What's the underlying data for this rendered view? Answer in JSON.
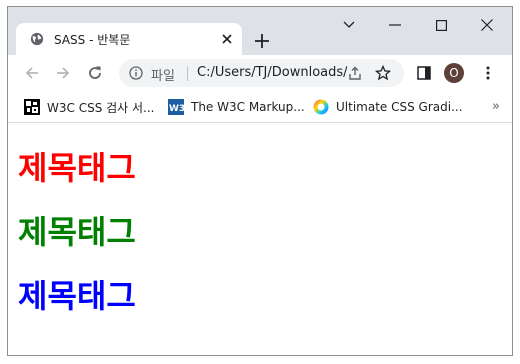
{
  "browser": {
    "tab": {
      "title": "SASS - 반복문",
      "favicon": "globe-icon"
    },
    "window_controls": [
      "chevron-down-icon",
      "minimize-icon",
      "maximize-icon",
      "close-icon"
    ],
    "omnibox": {
      "chip": "파일",
      "url": "C:/Users/TJ/Downloads/",
      "info_icon": "info-icon"
    },
    "profile_initial": "O",
    "bookmarks": [
      {
        "label": "W3C CSS 검사 서...",
        "icon": "w3c-validator-icon"
      },
      {
        "label": "The W3C Markup...",
        "icon": "w3c-logo-icon"
      },
      {
        "label": "Ultimate CSS Gradi...",
        "icon": "gradient-circle-icon"
      }
    ],
    "bookmarks_more": "»"
  },
  "page": {
    "headings": [
      {
        "text": "제목태그",
        "color": "#ff0000"
      },
      {
        "text": "제목태그",
        "color": "#008000"
      },
      {
        "text": "제목태그",
        "color": "#0000ff"
      }
    ]
  },
  "colors": {
    "tabstrip": "#dee1e6",
    "omnibox": "#f1f3f4",
    "avatar": "#5d4037"
  }
}
